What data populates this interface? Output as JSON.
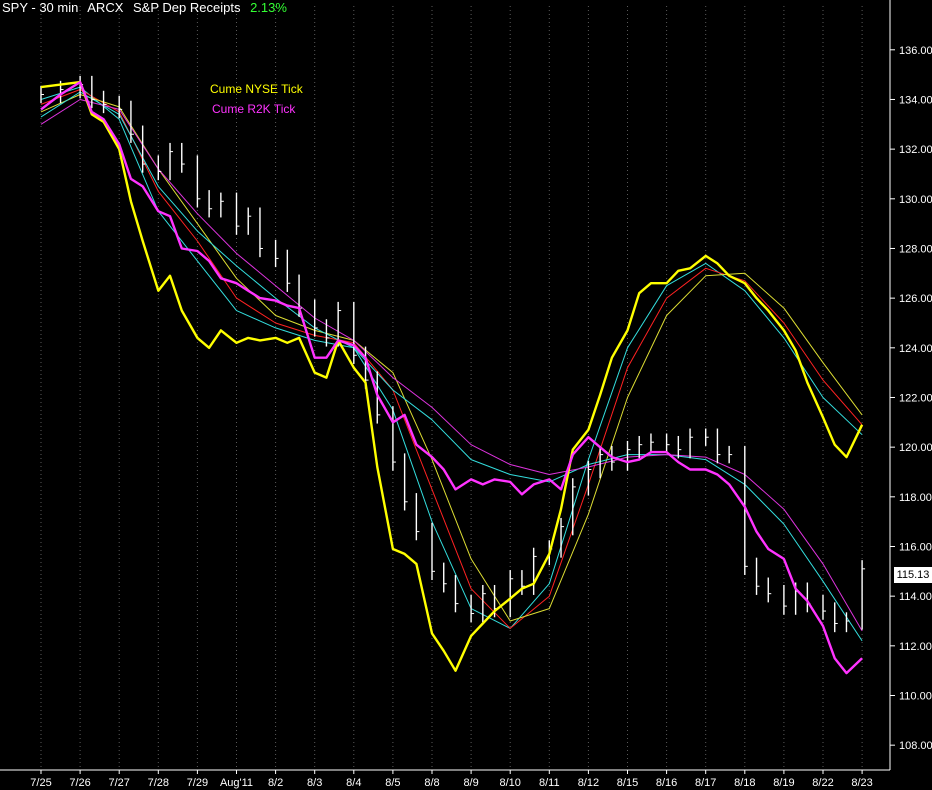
{
  "header": {
    "symbol": "SPY - 30 min",
    "exchange": "ARCX",
    "description": "S&P Dep Receipts",
    "change_pct": "2.13%"
  },
  "legend": {
    "nyse_label": "Cume NYSE Tick",
    "r2k_label": "Cume R2K Tick"
  },
  "last_price": "115.13",
  "colors": {
    "background": "#000000",
    "price": "#ffffff",
    "nyse_tick": "#ffff00",
    "r2k_tick": "#ff33ff",
    "ma_cyan": "#33dddd",
    "ma_red": "#ff2222",
    "ma_yellow_thin": "#dddd33",
    "ma_magenta_thin": "#dd33dd",
    "change_positive": "#33ff33"
  },
  "chart_data": {
    "type": "line",
    "y_axis": {
      "side": "right",
      "ylim": [
        107,
        137.2
      ],
      "ticks": [
        108,
        110,
        112,
        114,
        116,
        118,
        120,
        122,
        124,
        126,
        128,
        130,
        132,
        134,
        136
      ]
    },
    "x_axis": {
      "categories": [
        "7/25",
        "7/26",
        "7/27",
        "7/28",
        "7/29",
        "Aug'11",
        "8/2",
        "8/3",
        "8/4",
        "8/5",
        "8/8",
        "8/9",
        "8/10",
        "8/11",
        "8/12",
        "8/15",
        "8/16",
        "8/17",
        "8/18",
        "8/19",
        "8/22",
        "8/23"
      ]
    },
    "grid": "vertical dotted",
    "series": [
      {
        "name": "SPY",
        "style": "price bars",
        "x": [
          0.0,
          0.5,
          1.0,
          1.3,
          1.6,
          2.0,
          2.3,
          2.6,
          3.0,
          3.3,
          3.6,
          4.0,
          4.3,
          4.6,
          5.0,
          5.3,
          5.6,
          6.0,
          6.3,
          6.6,
          7.0,
          7.3,
          7.6,
          8.0,
          8.3,
          8.6,
          9.0,
          9.3,
          9.6,
          10.0,
          10.3,
          10.6,
          11.0,
          11.3,
          11.6,
          12.0,
          12.3,
          12.6,
          13.0,
          13.3,
          13.6,
          14.0,
          14.3,
          14.6,
          15.0,
          15.3,
          15.6,
          16.0,
          16.3,
          16.6,
          17.0,
          17.3,
          17.6,
          18.0,
          18.3,
          18.6,
          19.0,
          19.3,
          19.6,
          20.0,
          20.3,
          20.6,
          21.0
        ],
        "y": [
          134.2,
          134.4,
          134.6,
          134.0,
          133.8,
          133.6,
          132.6,
          131.4,
          131.1,
          131.9,
          131.4,
          130.0,
          129.6,
          129.9,
          128.9,
          129.3,
          128.0,
          127.6,
          126.6,
          125.6,
          124.8,
          124.4,
          125.5,
          123.7,
          122.7,
          121.3,
          119.4,
          117.8,
          116.6,
          115.0,
          114.5,
          113.7,
          113.3,
          114.1,
          113.5,
          114.7,
          114.4,
          115.6,
          115.9,
          116.8,
          118.4,
          119.1,
          119.7,
          119.4,
          119.9,
          120.1,
          120.2,
          120.1,
          119.9,
          120.4,
          120.4,
          119.7,
          119.7,
          115.2,
          114.4,
          114.1,
          113.6,
          114.2,
          113.7,
          113.4,
          112.9,
          113.0,
          115.1
        ]
      },
      {
        "name": "Cume NYSE Tick",
        "x": [
          0.0,
          0.5,
          1.0,
          1.3,
          1.6,
          2.0,
          2.3,
          2.6,
          3.0,
          3.3,
          3.6,
          4.0,
          4.3,
          4.6,
          5.0,
          5.3,
          5.6,
          6.0,
          6.3,
          6.6,
          7.0,
          7.3,
          7.6,
          8.0,
          8.3,
          8.6,
          9.0,
          9.3,
          9.6,
          10.0,
          10.3,
          10.6,
          11.0,
          11.3,
          11.6,
          12.0,
          12.3,
          12.6,
          13.0,
          13.3,
          13.6,
          14.0,
          14.3,
          14.6,
          15.0,
          15.3,
          15.6,
          16.0,
          16.3,
          16.6,
          17.0,
          17.3,
          17.6,
          18.0,
          18.3,
          18.6,
          19.0,
          19.3,
          19.6,
          20.0,
          20.3,
          20.6,
          21.0
        ],
        "y": [
          134.5,
          134.6,
          134.7,
          133.4,
          133.1,
          132.0,
          129.9,
          128.3,
          126.3,
          126.9,
          125.5,
          124.4,
          124.0,
          124.7,
          124.2,
          124.4,
          124.3,
          124.4,
          124.2,
          124.4,
          123.0,
          122.8,
          124.3,
          123.2,
          122.6,
          119.2,
          115.9,
          115.7,
          115.3,
          112.5,
          111.8,
          111.0,
          112.4,
          112.9,
          113.4,
          113.9,
          114.3,
          114.5,
          115.7,
          117.5,
          119.9,
          120.7,
          122.1,
          123.6,
          124.7,
          126.2,
          126.6,
          126.6,
          127.1,
          127.2,
          127.7,
          127.4,
          126.9,
          126.6,
          126.0,
          125.5,
          124.7,
          123.9,
          122.6,
          121.2,
          120.1,
          119.6,
          120.9
        ]
      },
      {
        "name": "Cume R2K Tick",
        "x": [
          0.0,
          0.5,
          1.0,
          1.3,
          1.6,
          2.0,
          2.3,
          2.6,
          3.0,
          3.3,
          3.6,
          4.0,
          4.3,
          4.6,
          5.0,
          5.3,
          5.6,
          6.0,
          6.3,
          6.6,
          7.0,
          7.3,
          7.6,
          8.0,
          8.3,
          8.6,
          9.0,
          9.3,
          9.6,
          10.0,
          10.3,
          10.6,
          11.0,
          11.3,
          11.6,
          12.0,
          12.3,
          12.6,
          13.0,
          13.3,
          13.6,
          14.0,
          14.3,
          14.6,
          15.0,
          15.3,
          15.6,
          16.0,
          16.3,
          16.6,
          17.0,
          17.3,
          17.6,
          18.0,
          18.3,
          18.6,
          19.0,
          19.3,
          19.6,
          20.0,
          20.3,
          20.6,
          21.0
        ],
        "y": [
          133.6,
          134.2,
          134.7,
          133.5,
          133.2,
          132.2,
          130.8,
          130.5,
          129.5,
          129.3,
          128.0,
          127.9,
          127.5,
          126.8,
          126.6,
          126.3,
          126.0,
          125.9,
          125.7,
          125.6,
          123.6,
          123.6,
          124.3,
          124.1,
          123.6,
          122.1,
          121.0,
          121.3,
          120.1,
          119.6,
          119.1,
          118.3,
          118.7,
          118.5,
          118.7,
          118.6,
          118.1,
          118.5,
          118.7,
          118.3,
          119.7,
          120.4,
          120.0,
          119.6,
          119.4,
          119.5,
          119.8,
          119.8,
          119.4,
          119.1,
          119.1,
          118.9,
          118.5,
          117.6,
          116.6,
          115.9,
          115.5,
          114.3,
          113.8,
          112.8,
          111.5,
          110.9,
          111.5
        ]
      },
      {
        "name": "",
        "style": "moving average",
        "x": [
          0,
          1,
          2,
          3,
          4,
          5,
          6,
          7,
          8,
          9,
          10,
          11,
          12,
          13,
          14,
          15,
          16,
          17,
          18,
          19,
          20,
          21
        ],
        "y": [
          134.0,
          134.5,
          133.2,
          129.5,
          127.5,
          125.5,
          124.8,
          124.3,
          124.0,
          121.5,
          117.0,
          113.5,
          112.7,
          114.5,
          119.5,
          124.0,
          126.5,
          127.4,
          126.3,
          124.4,
          122.0,
          120.5
        ]
      },
      {
        "name": "",
        "style": "moving average",
        "x": [
          0,
          1,
          2,
          3,
          4,
          5,
          6,
          7,
          8,
          9,
          10,
          11,
          12,
          13,
          14,
          15,
          16,
          17,
          18,
          19,
          20,
          21
        ],
        "y": [
          133.8,
          134.4,
          133.5,
          130.3,
          128.3,
          126.0,
          125.0,
          124.5,
          124.2,
          122.3,
          118.3,
          114.3,
          112.7,
          114.0,
          118.5,
          123.2,
          126.0,
          127.2,
          126.7,
          125.0,
          122.7,
          120.9
        ]
      },
      {
        "name": "",
        "style": "moving average",
        "x": [
          0,
          1,
          2,
          3,
          4,
          5,
          6,
          7,
          8,
          9,
          10,
          11,
          12,
          13,
          14,
          15,
          16,
          17,
          18,
          19,
          20,
          21
        ],
        "y": [
          133.5,
          134.2,
          133.7,
          131.2,
          129.0,
          126.8,
          125.3,
          124.7,
          124.3,
          123.0,
          119.5,
          115.5,
          113.0,
          113.5,
          117.3,
          122.0,
          125.3,
          126.9,
          127.0,
          125.6,
          123.4,
          121.3
        ]
      },
      {
        "name": "",
        "style": "moving average",
        "x": [
          0,
          1,
          2,
          3,
          4,
          5,
          6,
          7,
          8,
          9,
          10,
          11,
          12,
          13,
          14,
          15,
          16,
          17,
          18,
          19,
          20,
          21
        ],
        "y": [
          133.3,
          134.3,
          133.4,
          130.5,
          128.7,
          127.3,
          126.0,
          124.8,
          124.0,
          122.3,
          121.1,
          119.5,
          118.9,
          118.6,
          119.3,
          119.7,
          119.7,
          119.5,
          118.5,
          116.9,
          114.6,
          112.2
        ]
      },
      {
        "name": "",
        "style": "moving average",
        "x": [
          0,
          1,
          2,
          3,
          4,
          5,
          6,
          7,
          8,
          9,
          10,
          11,
          12,
          13,
          14,
          15,
          16,
          17,
          18,
          19,
          20,
          21
        ],
        "y": [
          133.0,
          134.0,
          133.6,
          131.2,
          129.4,
          127.8,
          126.5,
          125.2,
          124.3,
          122.8,
          121.6,
          120.1,
          119.3,
          118.9,
          119.2,
          119.6,
          119.7,
          119.6,
          118.9,
          117.5,
          115.3,
          112.6
        ]
      }
    ]
  }
}
